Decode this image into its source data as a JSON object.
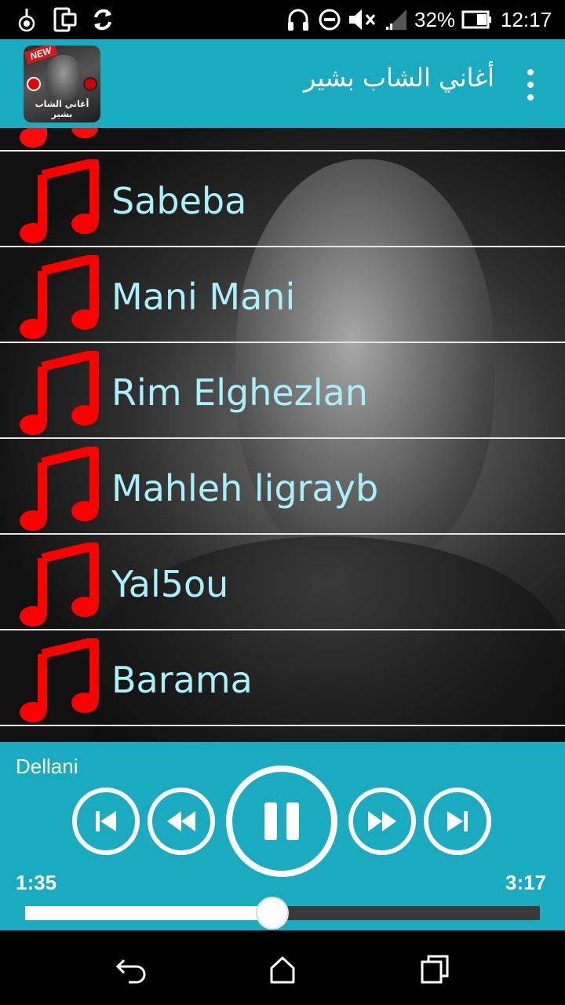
{
  "status_bar": {
    "battery_percent": "32%",
    "time": "12:17",
    "icons": [
      "app-notification-icon",
      "phone-rotate-icon",
      "sync-icon",
      "headphones-icon",
      "do-not-disturb-icon",
      "volume-muted-icon",
      "signal-icon",
      "battery-icon"
    ]
  },
  "app_bar": {
    "title": "أغاني الشاب بشير",
    "icon_badge": "NEW",
    "icon_caption": "أغاني الشاب بشير",
    "menu_icon": "overflow-menu-icon"
  },
  "songs": [
    {
      "title": "Sabeba"
    },
    {
      "title": "Mani Mani"
    },
    {
      "title": "Rim Elghezlan"
    },
    {
      "title": "Mahleh ligrayb"
    },
    {
      "title": "Yal5ou"
    },
    {
      "title": "Barama"
    }
  ],
  "player": {
    "now_playing": "Dellani",
    "current_time": "1:35",
    "total_time": "3:17",
    "progress_fraction": 0.48,
    "controls": [
      "skip-previous-icon",
      "rewind-icon",
      "pause-icon",
      "fast-forward-icon",
      "skip-next-icon"
    ]
  },
  "colors": {
    "accent": "#1aabc1",
    "song_text": "#a8f0fb",
    "note_icon": "#ff0000"
  },
  "nav_bar": {
    "icons": [
      "back-icon",
      "home-icon",
      "recents-icon"
    ]
  }
}
